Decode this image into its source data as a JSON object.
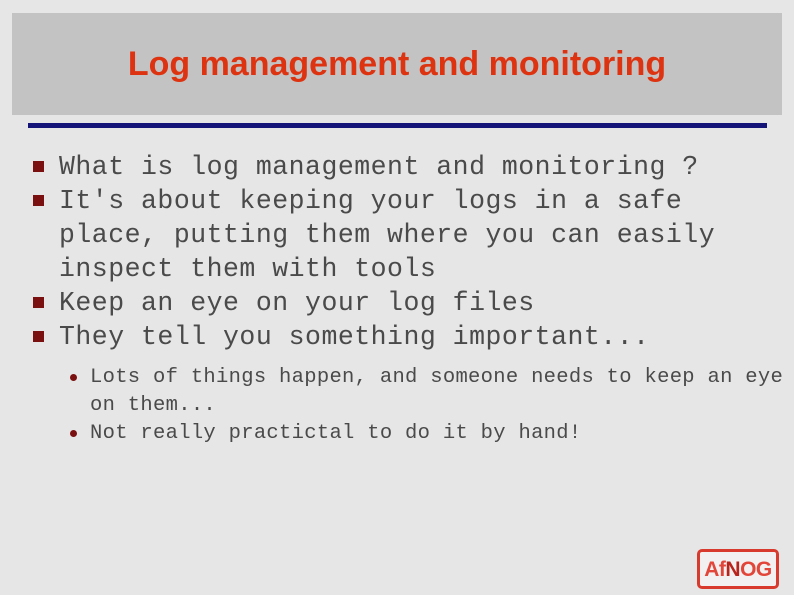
{
  "slide": {
    "title": "Log management and monitoring",
    "title_color": "#dd3311",
    "band_color": "#c3c3c3",
    "rule_color": "#141478",
    "background_color": "#e6e6e6",
    "body_text_color": "#4a4a4a",
    "bullet_color": "#7b1010",
    "bullets": [
      {
        "level": 1,
        "text": "What is log management and monitoring ?"
      },
      {
        "level": 1,
        "text": "It's about keeping your logs in a safe place, putting them where you can easily inspect them with tools"
      },
      {
        "level": 1,
        "text": "Keep an eye on your log files"
      },
      {
        "level": 1,
        "text": "They tell you something important..."
      },
      {
        "level": 2,
        "text": "Lots of things happen, and someone needs to keep an eye on them..."
      },
      {
        "level": 2,
        "text": "Not really practictal to do it by hand!"
      }
    ]
  },
  "logo": {
    "name": "afnog-logo",
    "text_prefix": "Af",
    "text_accent": "N",
    "text_suffix": "OG",
    "border_color": "#d83a2e",
    "text_color": "#e2463a",
    "accent_color": "#b8241c"
  }
}
